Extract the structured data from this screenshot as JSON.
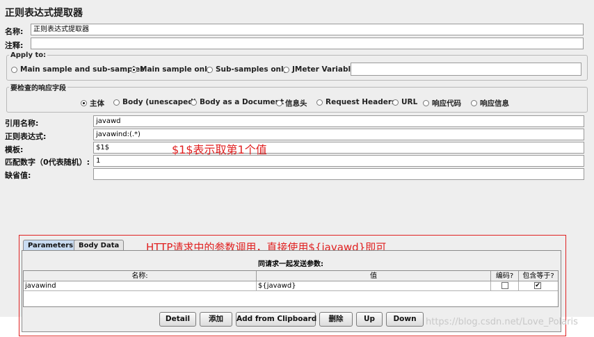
{
  "window": {
    "title": "正则表达式提取器"
  },
  "name_row": {
    "label": "名称:",
    "value": "正则表达式提取器"
  },
  "comment_row": {
    "label": "注释:",
    "value": ""
  },
  "apply_to": {
    "legend": "Apply to:",
    "options": [
      "Main sample and sub-samples",
      "Main sample only",
      "Sub-samples only",
      "JMeter Variable"
    ],
    "selected": "Main sample only",
    "variable_value": ""
  },
  "field_to_check": {
    "legend": "要检查的响应字段",
    "options": [
      "主体",
      "Body (unescaped)",
      "Body as a Document",
      "信息头",
      "Request Headers",
      "URL",
      "响应代码",
      "响应信息"
    ],
    "selected": "主体"
  },
  "extractor": {
    "ref_name_label": "引用名称:",
    "ref_name_value": "javawd",
    "regex_label": "正则表达式:",
    "regex_value": "javawind:(.*)",
    "template_label": "模板:",
    "template_value": "$1$",
    "match_no_label": "匹配数字（0代表随机）:",
    "match_no_value": "1",
    "default_label": "缺省值:",
    "default_value": ""
  },
  "annotations": {
    "template_note": "$1$表示取第1个值",
    "param_note": "HTTP请求中的参数调用，直接使用${javawd}即可"
  },
  "tabs": [
    {
      "label": "Parameters",
      "active": true
    },
    {
      "label": "Body Data",
      "active": false
    }
  ],
  "params_table": {
    "caption": "同请求一起发送参数:",
    "columns": [
      "名称:",
      "值",
      "编码?",
      "包含等于?"
    ],
    "rows": [
      {
        "name": "javawind",
        "value": "${javawd}",
        "encode": false,
        "include_equals": true,
        "include_equals_mark": "✔"
      }
    ]
  },
  "buttons": {
    "detail": "Detail",
    "add": "添加",
    "clipboard": "Add from Clipboard",
    "delete": "删除",
    "up": "Up",
    "down": "Down"
  },
  "watermark": "https://blog.csdn.net/Love_Polaris"
}
